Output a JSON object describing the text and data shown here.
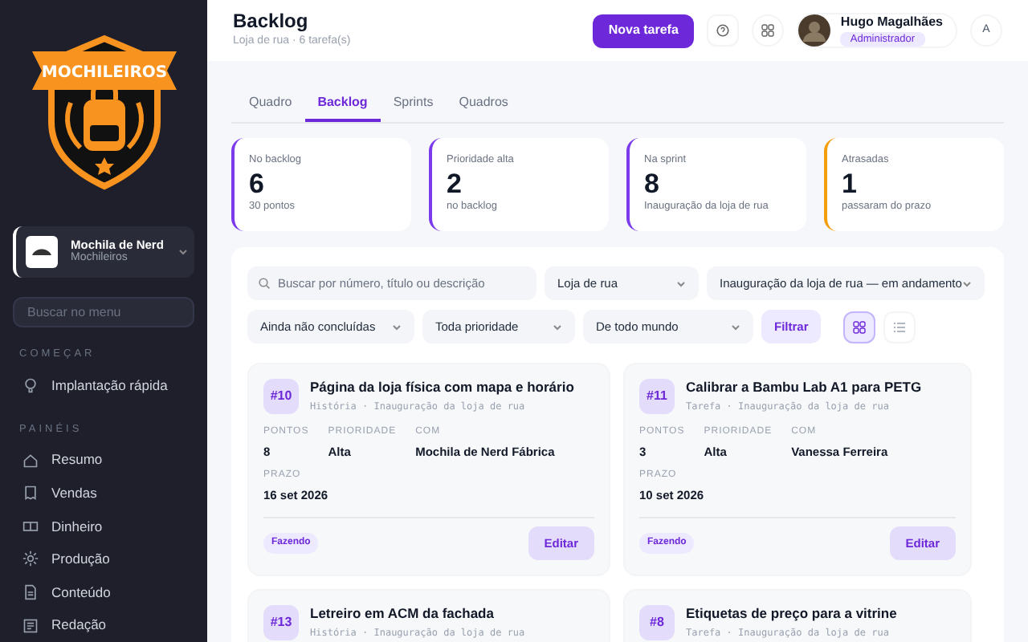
{
  "logo": {
    "text": "MOCHILEIROS"
  },
  "workspace": {
    "name": "Mochila de Nerd",
    "subtitle": "Mochileiros"
  },
  "sidebar": {
    "search": {
      "placeholder": "Buscar no menu"
    },
    "sections": [
      {
        "title": "COMEÇAR",
        "items": [
          {
            "label": "Implantação rápida"
          }
        ]
      },
      {
        "title": "PAINÉIS",
        "items": [
          {
            "label": "Resumo"
          },
          {
            "label": "Vendas"
          },
          {
            "label": "Dinheiro"
          },
          {
            "label": "Produção"
          },
          {
            "label": "Conteúdo"
          },
          {
            "label": "Redação"
          }
        ]
      }
    ]
  },
  "header": {
    "title": "Backlog",
    "subtitle": "Loja de rua · 6 tarefa(s)",
    "primary_button": "Nova tarefa",
    "user": {
      "name": "Hugo Magalhães",
      "role": "Administrador"
    },
    "language": "A"
  },
  "tabs": [
    {
      "label": "Quadro",
      "selected": false
    },
    {
      "label": "Backlog",
      "selected": true
    },
    {
      "label": "Sprints",
      "selected": false
    },
    {
      "label": "Quadros",
      "selected": false
    }
  ],
  "stats": [
    {
      "label": "No backlog",
      "value": "6",
      "note": "30 pontos",
      "color": "#7c3aed"
    },
    {
      "label": "Prioridade alta",
      "value": "2",
      "note": "no backlog",
      "color": "#7c3aed"
    },
    {
      "label": "Na sprint",
      "value": "8",
      "note": "Inauguração da loja de rua",
      "color": "#7c3aed"
    },
    {
      "label": "Atrasadas",
      "value": "1",
      "note": "passaram do prazo",
      "color": "#f59e0b"
    }
  ],
  "filters": {
    "search": {
      "placeholder": "Buscar por número, título ou descrição"
    },
    "selects": [
      {
        "value": "Loja de rua"
      },
      {
        "value": "Inauguração da loja de rua — em andamento"
      },
      {
        "value": "Ainda não concluídas"
      },
      {
        "value": "Toda prioridade"
      },
      {
        "value": "De todo mundo"
      }
    ],
    "button": "Filtrar",
    "views": [
      {
        "kind": "grid",
        "selected": true
      },
      {
        "kind": "list",
        "selected": false
      }
    ]
  },
  "tasks": [
    {
      "number": "#10",
      "title": "Página da loja física com mapa e horário",
      "meta": "História · Inauguração da loja de rua",
      "fields": [
        {
          "label": "PONTOS",
          "value": "8"
        },
        {
          "label": "PRIORIDADE",
          "value": "Alta"
        },
        {
          "label": "COM",
          "value": "Mochila de Nerd Fábrica"
        },
        {
          "label": "PRAZO",
          "value": "16 set 2026"
        }
      ],
      "status": "Fazendo",
      "action": "Editar"
    },
    {
      "number": "#11",
      "title": "Calibrar a Bambu Lab A1 para PETG",
      "meta": "Tarefa · Inauguração da loja de rua",
      "fields": [
        {
          "label": "PONTOS",
          "value": "3"
        },
        {
          "label": "PRIORIDADE",
          "value": "Alta"
        },
        {
          "label": "COM",
          "value": "Vanessa Ferreira"
        },
        {
          "label": "PRAZO",
          "value": "10 set 2026"
        }
      ],
      "status": "Fazendo",
      "action": "Editar"
    },
    {
      "number": "#13",
      "title": "Letreiro em ACM da fachada",
      "meta": "História · Inauguração da loja de rua"
    },
    {
      "number": "#8",
      "title": "Etiquetas de preço para a vitrine",
      "meta": "Tarefa · Inauguração da loja de rua"
    }
  ]
}
